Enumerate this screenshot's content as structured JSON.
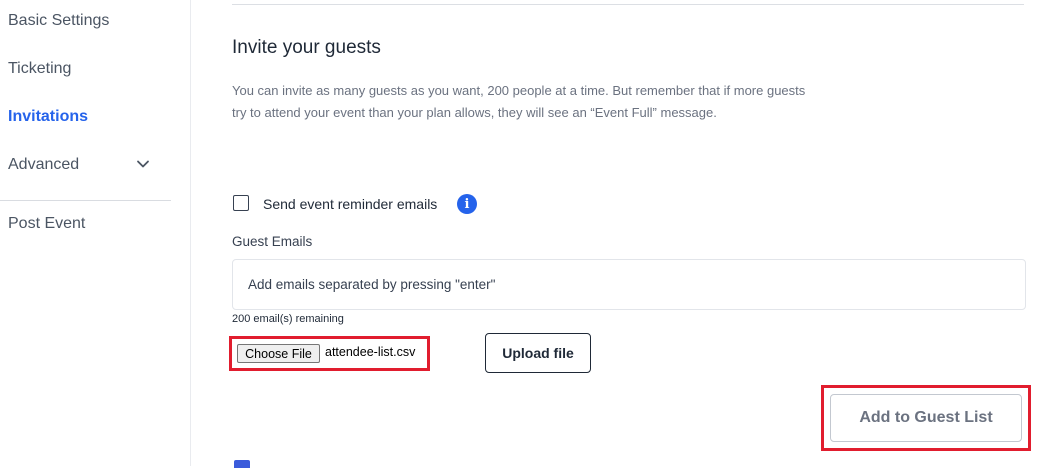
{
  "sidebar": {
    "items": [
      {
        "label": "Basic Settings"
      },
      {
        "label": "Ticketing"
      },
      {
        "label": "Invitations"
      },
      {
        "label": "Advanced"
      },
      {
        "label": "Post Event"
      }
    ],
    "active_color": "#2563eb"
  },
  "main": {
    "title": "Invite your guests",
    "description": "You can invite as many guests as you want, 200 people at a time. But remember that if more guests try to attend your event than your plan allows, they will see an “Event Full” message.",
    "reminder_checkbox": {
      "label": "Send event reminder emails",
      "checked": false
    },
    "guest_emails": {
      "label": "Guest Emails",
      "placeholder": "Add emails separated by pressing \"enter\"",
      "remaining": "200 email(s) remaining"
    },
    "file_input": {
      "button_label": "Choose File",
      "file_name": "attendee-list.csv"
    },
    "upload_button": "Upload file",
    "add_button": "Add to Guest List"
  },
  "icons": {
    "info": "info-icon",
    "chevron": "chevron-down-icon"
  },
  "colors": {
    "accent": "#2563eb",
    "highlight": "#e11d2e"
  }
}
